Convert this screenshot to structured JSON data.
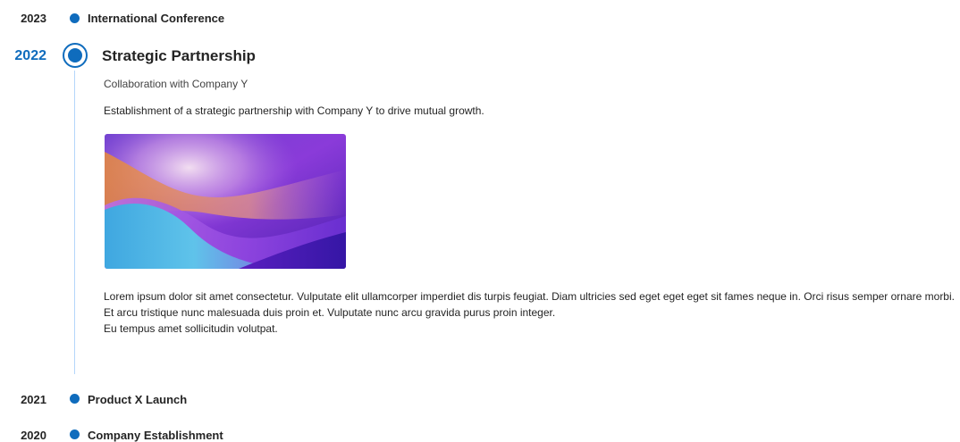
{
  "timeline": {
    "items": [
      {
        "year": "2023",
        "title": "International Conference"
      },
      {
        "year": "2022",
        "title": "Strategic Partnership",
        "subtitle": "Collaboration with Company Y",
        "description": "Establishment of a strategic partnership with Company Y to drive mutual growth.",
        "image": "abstract-gradient-image",
        "body_line1": "Lorem ipsum dolor sit amet consectetur. Vulputate elit ullamcorper imperdiet dis turpis feugiat. Diam ultricies sed eget eget eget sit fames neque in. Orci risus semper ornare morbi. Et arcu tristique nunc malesuada duis proin et. Vulputate nunc arcu gravida purus proin integer.",
        "body_line2": "Eu tempus amet sollicitudin volutpat."
      },
      {
        "year": "2021",
        "title": "Product X Launch"
      },
      {
        "year": "2020",
        "title": "Company Establishment"
      }
    ],
    "active_index": 1
  },
  "colors": {
    "accent": "#0f6cbd",
    "line": "#b4d6fa",
    "text": "#242424"
  }
}
